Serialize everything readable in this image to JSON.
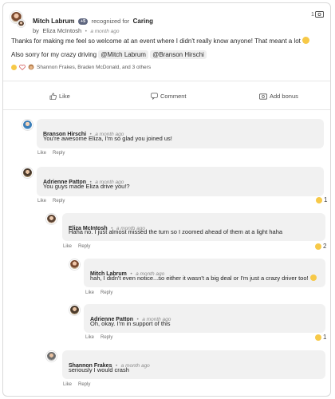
{
  "post": {
    "author": "Mitch Labrum",
    "badge": "+5",
    "recognized_prefix": "recognized for",
    "value": "Caring",
    "by_prefix": "by",
    "by_name": "Eliza McIntosh",
    "time": "a month ago",
    "bonus_count": "1",
    "message": "Thanks for making me feel so welcome at an event where I didn't really know anyone! That meant a lot",
    "message2": "Also sorry for my crazy driving",
    "mentions": [
      "@Mitch Labrum",
      "@Branson Hirschi"
    ],
    "reactors": "Shannon Frakes, Braden McDonald, and 3 others"
  },
  "actions": {
    "like": "Like",
    "comment": "Comment",
    "add_bonus": "Add bonus"
  },
  "comments": [
    {
      "author": "Branson Hirschi",
      "time": "a month ago",
      "text": "You're awesome Eliza, I'm so glad you joined us!",
      "like": "Like",
      "reply": "Reply",
      "reactions": ""
    },
    {
      "author": "Adrienne Patton",
      "time": "a month ago",
      "text": "You guys made Eliza drive you!?",
      "like": "Like",
      "reply": "Reply",
      "reactions": "1"
    },
    {
      "author": "Eliza McIntosh",
      "time": "a month ago",
      "text": "Haha no. I just almost missed the turn so I zoomed ahead of them at a light haha",
      "like": "Like",
      "reply": "Reply",
      "reactions": "2"
    },
    {
      "author": "Mitch Labrum",
      "time": "a month ago",
      "text": "hah, I didn't even notice...so either it wasn't a big deal or I'm just a crazy driver too!",
      "like": "Like",
      "reply": "Reply",
      "reactions": ""
    },
    {
      "author": "Adrienne Patton",
      "time": "a month ago",
      "text": "Oh, okay. I'm in support of this",
      "like": "Like",
      "reply": "Reply",
      "reactions": "1"
    },
    {
      "author": "Shannon Frakes",
      "time": "a month ago",
      "text": "seriously I would crash",
      "like": "Like",
      "reply": "Reply",
      "reactions": ""
    }
  ]
}
